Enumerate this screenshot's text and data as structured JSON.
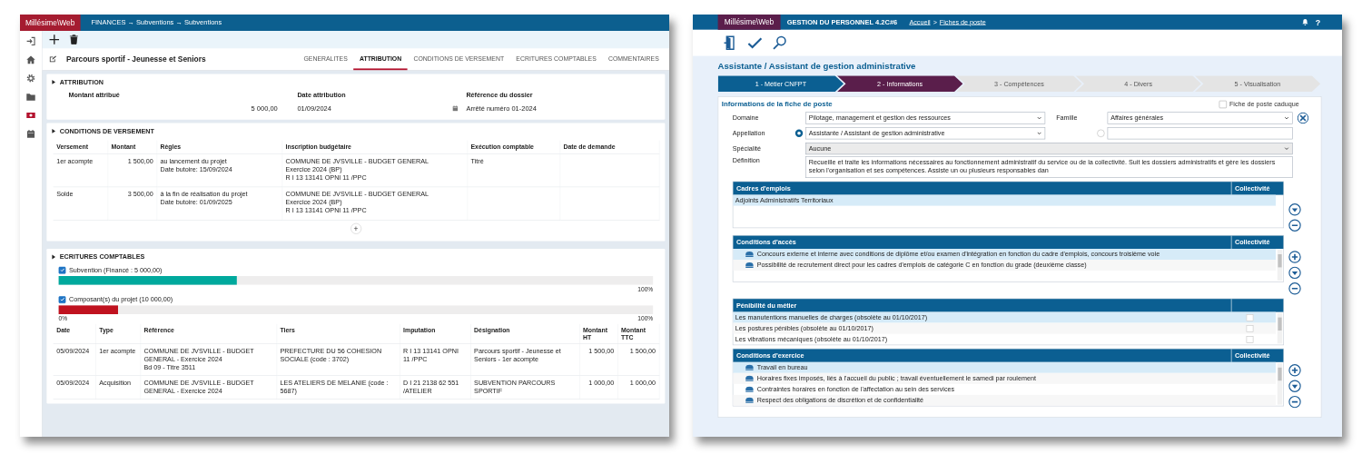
{
  "left": {
    "logo": "Millésime\\Web",
    "breadcrumb": "FINANCES → Subventions → Subventions",
    "sidebar": [
      {
        "kind": "login",
        "selected": false
      },
      {
        "kind": "home",
        "selected": false
      },
      {
        "kind": "settings",
        "selected": false
      },
      {
        "kind": "folder",
        "selected": false
      },
      {
        "kind": "money",
        "selected": true
      },
      {
        "kind": "calendar",
        "selected": false
      }
    ],
    "record_title": "Parcours sportif - Jeunesse et Seniors",
    "tabs": [
      {
        "label": "GENERALITES",
        "selected": false
      },
      {
        "label": "ATTRIBUTION",
        "selected": true
      },
      {
        "label": "CONDITIONS DE VERSEMENT",
        "selected": false
      },
      {
        "label": "ECRITURES COMPTABLES",
        "selected": false
      },
      {
        "label": "COMMENTAIRES",
        "selected": false
      }
    ],
    "attribution": {
      "title": "ATTRIBUTION",
      "fields": [
        {
          "kind": "amount",
          "label": "Montant attribué",
          "value": "5 000,00"
        },
        {
          "kind": "date",
          "label": "Date attribution",
          "value": "01/09/2024"
        },
        {
          "kind": "text",
          "label": "Référence du dossier",
          "value": "Arrêté numéro 01-2024"
        }
      ]
    },
    "payment_conditions": {
      "title": "CONDITIONS DE VERSEMENT",
      "columns": [
        "Versement",
        "Montant",
        "Règles",
        "Inscription budgétaire",
        "Exécution comptable",
        "Date de demande"
      ],
      "rows": [
        [
          [
            "1er acompte"
          ],
          [
            "1 500,00"
          ],
          [
            "au lancement du projet",
            "Date butoire: 15/09/2024"
          ],
          [
            "COMMUNE DE JVSVILLE - BUDGET GENERAL",
            "Exercice 2024 (BP)",
            "R I 13 13141 OPNI 11 /PPC"
          ],
          [
            "Titré"
          ],
          []
        ],
        [
          [
            "Solde"
          ],
          [
            "3 500,00"
          ],
          [
            "à la fin de réalisation du projet",
            "Date butoire: 01/09/2025"
          ],
          [
            "COMMUNE DE JVSVILLE - BUDGET GENERAL",
            "Exercice 2024 (BP)",
            "R I 13 13141 OPNI 11 /PPC"
          ],
          [],
          []
        ]
      ],
      "add_button": "+"
    },
    "accounting": {
      "title": "ECRITURES COMPTABLES",
      "bars": [
        {
          "label": "Subvention (Financé : 5 000,00)",
          "checked": true,
          "level": 0.3,
          "color": "#00a99d",
          "max_label": "100%"
        },
        {
          "label": "Composant(s) du projet (10 000,00)",
          "checked": true,
          "level": 0.1,
          "color": "#c0121f",
          "min_label": "0%",
          "max_label": "100%"
        }
      ],
      "columns": [
        "Date",
        "Type",
        "Référence",
        "Tiers",
        "Imputation",
        "Désignation",
        "Montant HT",
        "Montant TTC"
      ],
      "rows": [
        [
          "05/09/2024",
          "1er acompte",
          "COMMUNE DE JVSVILLE - BUDGET GENERAL - Exercice 2024\nBd 09 - Titre 3511",
          "PREFECTURE DU 56 COHESION SOCIALE (code : 3702)",
          "R I 13 13141 OPNI 11 /PPC",
          "Parcours sportif - Jeunesse et Seniors - 1er acompte",
          "1 500,00",
          "1 500,00"
        ],
        [
          "05/09/2024",
          "Acquisition",
          "COMMUNE DE JVSVILLE - BUDGET GENERAL - Exercice 2024",
          "LES ATELIERS DE MELANIE (code : 5687)",
          "D I 21 2138 62 551 /ATELIER",
          "SUBVENTION PARCOURS SPORTIF",
          "1 000,00",
          "1 000,00"
        ]
      ]
    }
  },
  "right": {
    "logo": "Millésime\\Web",
    "module": "GESTION DU PERSONNEL 4.2C#6",
    "breadcrumb": [
      "Accueil",
      "Fiches de poste"
    ],
    "breadcrumb_separator": ">",
    "help": "?",
    "title": "Assistante / Assistant de gestion administrative",
    "steps": [
      {
        "label": "1 - Métier CNFPT",
        "done": true,
        "selected": false
      },
      {
        "label": "2 - Informations",
        "done": false,
        "selected": true
      },
      {
        "label": "3 - Compétences",
        "done": false,
        "selected": false
      },
      {
        "label": "4 - Divers",
        "done": false,
        "selected": false
      },
      {
        "label": "5 - Visualisation",
        "done": false,
        "selected": false
      }
    ],
    "form": {
      "title": "Informations de la fiche de poste",
      "obsolete": {
        "label": "Fiche de poste caduque",
        "checked": false
      },
      "domaine": {
        "label": "Domaine",
        "value": "Pilotage, management et gestion des ressources"
      },
      "famille": {
        "label": "Famille",
        "value": "Affaires générales"
      },
      "appellation": {
        "label": "Appellation",
        "selected": true,
        "value": "Assistante / Assistant de gestion administrative"
      },
      "appellation_alt": {
        "selected": false
      },
      "specialite": {
        "label": "Spécialité",
        "value": "Aucune",
        "disabled": true
      },
      "definition": {
        "label": "Définition",
        "value": "Recueille et traite les informations nécessaires au fonctionnement administratif du service ou de la collectivité. Suit les dossiers administratifs et gère les dossiers selon l'organisation et ses compétences. Assiste un ou plusieurs responsables dan"
      }
    },
    "grids": [
      {
        "title": "Cadres d'emplois",
        "column": "Collectivité",
        "kind": "plain",
        "actions": [
          {
            "kind": "down"
          },
          {
            "kind": "remove"
          }
        ],
        "rows": [
          {
            "text": "Adjoints Administratifs Territoriaux",
            "selected": true
          }
        ]
      },
      {
        "title": "Conditions d'accès",
        "column": "Collectivité",
        "kind": "icon",
        "actions": [
          {
            "kind": "add"
          },
          {
            "kind": "down"
          },
          {
            "kind": "remove"
          }
        ],
        "rows": [
          {
            "text": "Concours externe et interne avec conditions de diplôme et/ou examen d'intégration en fonction du cadre d'emplois, concours troisième voie",
            "selected": true
          },
          {
            "text": "Possibilité de recrutement direct pour les cadres d'emplois de catégorie C en fonction du grade (deuxième classe)",
            "selected": false
          }
        ]
      },
      {
        "title": "Pénibilité du métier",
        "kind": "checkbox",
        "rows": [
          {
            "text": "Les manutentions manuelles de charges (obsolète au 01/10/2017)",
            "selected": true,
            "checked": false
          },
          {
            "text": "Les postures pénibles (obsolète au 01/10/2017)",
            "selected": false,
            "checked": false
          },
          {
            "text": "Les vibrations mécaniques (obsolète au 01/10/2017)",
            "selected": false,
            "checked": false
          }
        ]
      },
      {
        "title": "Conditions d'exercice",
        "column": "Collectivité",
        "kind": "icon",
        "actions": [
          {
            "kind": "add"
          },
          {
            "kind": "down"
          },
          {
            "kind": "remove"
          }
        ],
        "rows": [
          {
            "text": "Travail en bureau",
            "selected": true
          },
          {
            "text": "Horaires fixes imposés, liés à l'accueil du public ; travail éventuellement le samedi par roulement",
            "selected": false
          },
          {
            "text": "Contraintes horaires en fonction de l'affectation au sein des services",
            "selected": false
          },
          {
            "text": "Respect des obligations de discrétion et de confidentialité",
            "selected": false
          }
        ]
      }
    ]
  }
}
